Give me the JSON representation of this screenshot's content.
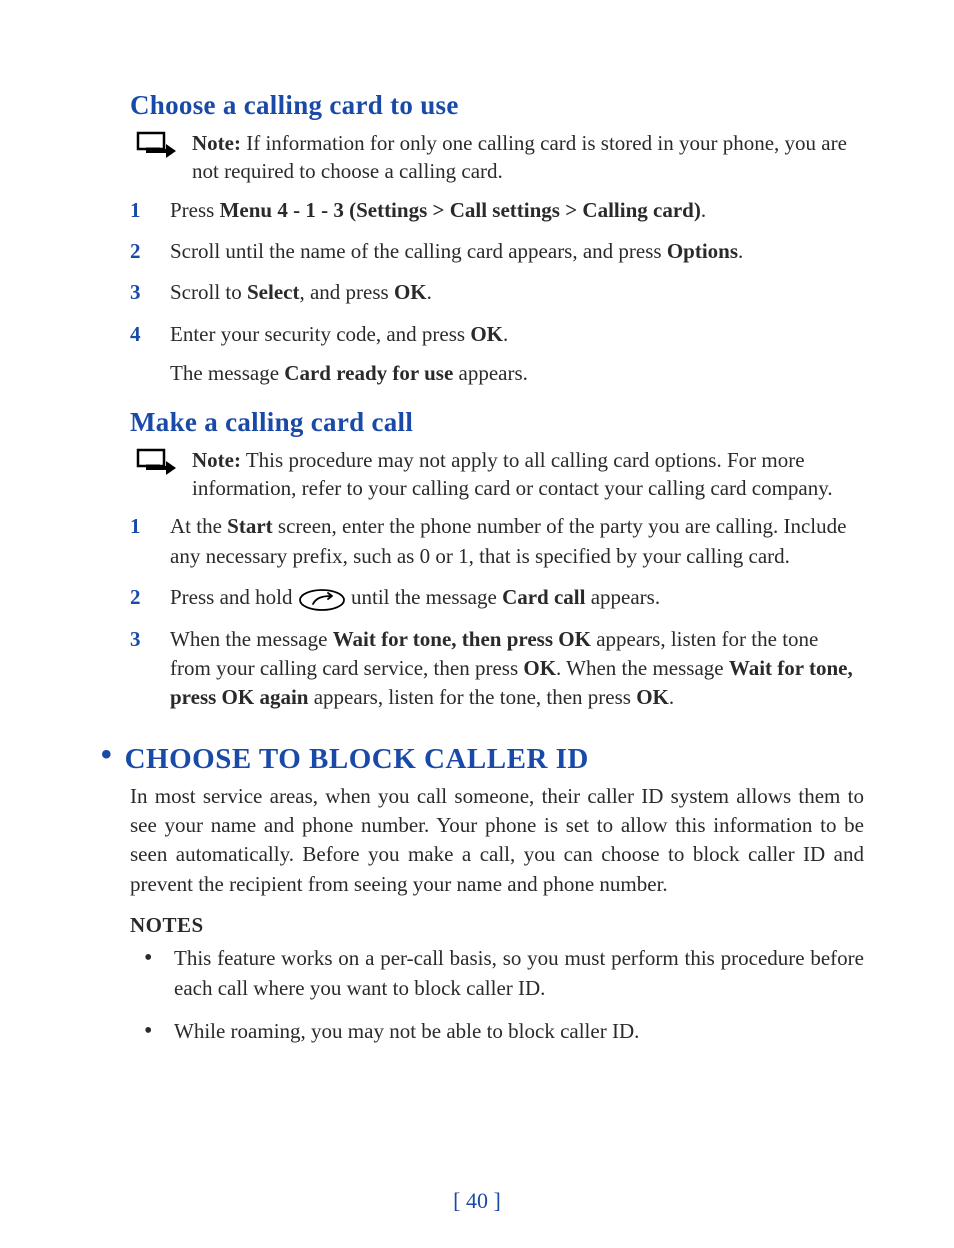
{
  "sections": [
    {
      "heading": "Choose a calling card to use",
      "note_label": "Note:",
      "note_text": " If information for only one calling card is stored in your phone, you are not required to choose a calling card.",
      "steps": [
        {
          "num": "1",
          "parts": [
            "Press ",
            {
              "b": "Menu 4 - 1 - 3 (Settings > Call settings > Calling card)"
            },
            "."
          ]
        },
        {
          "num": "2",
          "parts": [
            "Scroll until the name of the calling card appears, and press ",
            {
              "b": "Options"
            },
            "."
          ]
        },
        {
          "num": "3",
          "parts": [
            "Scroll to ",
            {
              "b": "Select"
            },
            ", and press ",
            {
              "b": "OK"
            },
            "."
          ]
        },
        {
          "num": "4",
          "parts": [
            "Enter your security code, and press ",
            {
              "b": "OK"
            },
            "."
          ],
          "sub": [
            "The message ",
            {
              "b": "Card ready for use"
            },
            " appears."
          ]
        }
      ]
    },
    {
      "heading": "Make a calling card call",
      "note_label": "Note:",
      "note_text": " This procedure may not apply to all calling card options. For more information, refer to your calling card or contact your calling card company.",
      "steps": [
        {
          "num": "1",
          "parts": [
            "At the ",
            {
              "b": "Start"
            },
            " screen, enter the phone number of the party you are calling. Include any necessary prefix, such as 0 or 1, that is specified by your calling card."
          ]
        },
        {
          "num": "2",
          "parts": [
            "Press and hold ",
            {
              "icon": "call-key"
            },
            " until the message ",
            {
              "b": "Card call"
            },
            " appears."
          ]
        },
        {
          "num": "3",
          "parts": [
            "When the message ",
            {
              "b": "Wait for tone, then press OK"
            },
            " appears, listen for the tone from your calling card service, then press ",
            {
              "b": "OK"
            },
            ". When the message ",
            {
              "b": "Wait for tone, press OK again"
            },
            " appears, listen for the tone, then press ",
            {
              "b": "OK"
            },
            "."
          ]
        }
      ]
    }
  ],
  "block_id": {
    "heading": "CHOOSE TO BLOCK CALLER ID",
    "para": "In most service areas, when you call someone, their caller ID system allows them to see your name and phone number. Your phone is set to allow this information to be seen automatically. Before you make a call, you can choose to block caller ID and prevent the recipient from seeing your name and phone number.",
    "notes_label": "NOTES",
    "notes": [
      "This feature works on a per-call basis, so you must perform this procedure before each call where you want to block caller ID.",
      "While roaming, you may not be able to block caller ID."
    ]
  },
  "page_number": "[ 40 ]"
}
